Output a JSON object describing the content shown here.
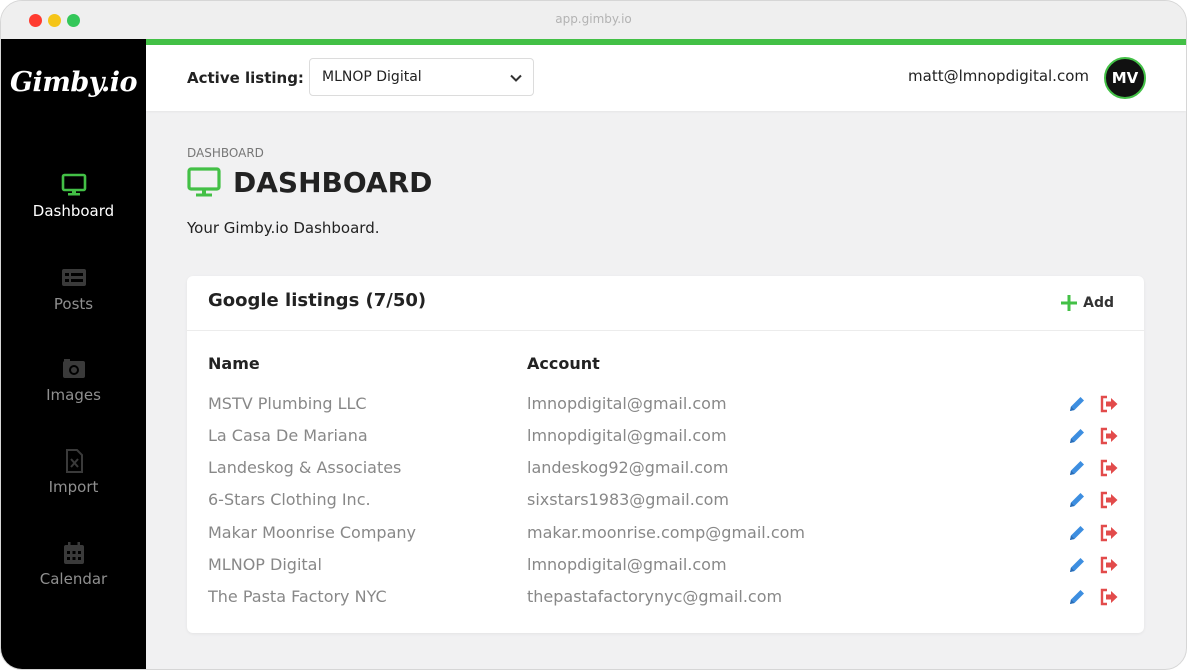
{
  "browser": {
    "url": "app.gimby.io"
  },
  "sidebar": {
    "logo": "Gimby.io",
    "items": [
      {
        "label": "Dashboard",
        "icon": "monitor-icon",
        "active": true
      },
      {
        "label": "Posts",
        "icon": "posts-icon",
        "active": false
      },
      {
        "label": "Images",
        "icon": "camera-icon",
        "active": false
      },
      {
        "label": "Import",
        "icon": "file-excel-icon",
        "active": false
      },
      {
        "label": "Calendar",
        "icon": "calendar-icon",
        "active": false
      }
    ]
  },
  "header": {
    "active_listing_label": "Active listing:",
    "active_listing_value": "MLNOP Digital",
    "user_email": "matt@lmnopdigital.com",
    "avatar_initials": "MV"
  },
  "page": {
    "breadcrumb": "DASHBOARD",
    "title": "DASHBOARD",
    "subtitle": "Your Gimby.io Dashboard."
  },
  "listings": {
    "title": "Google listings (7/50)",
    "add_label": "Add",
    "columns": [
      "Name",
      "Account"
    ],
    "rows": [
      {
        "name": "MSTV Plumbing LLC",
        "account": "lmnopdigital@gmail.com"
      },
      {
        "name": "La Casa De Mariana",
        "account": "lmnopdigital@gmail.com"
      },
      {
        "name": "Landeskog & Associates",
        "account": "landeskog92@gmail.com"
      },
      {
        "name": "6-Stars Clothing Inc.",
        "account": "sixstars1983@gmail.com"
      },
      {
        "name": "Makar Moonrise Company",
        "account": "makar.moonrise.comp@gmail.com"
      },
      {
        "name": "MLNOP Digital",
        "account": "lmnopdigital@gmail.com"
      },
      {
        "name": "The Pasta Factory NYC",
        "account": "thepastafactorynyc@gmail.com"
      }
    ]
  },
  "colors": {
    "accent_green": "#43c046",
    "edit_blue": "#3d8ee0",
    "logout_red": "#e24b4b",
    "sidebar_bg": "#000000"
  }
}
